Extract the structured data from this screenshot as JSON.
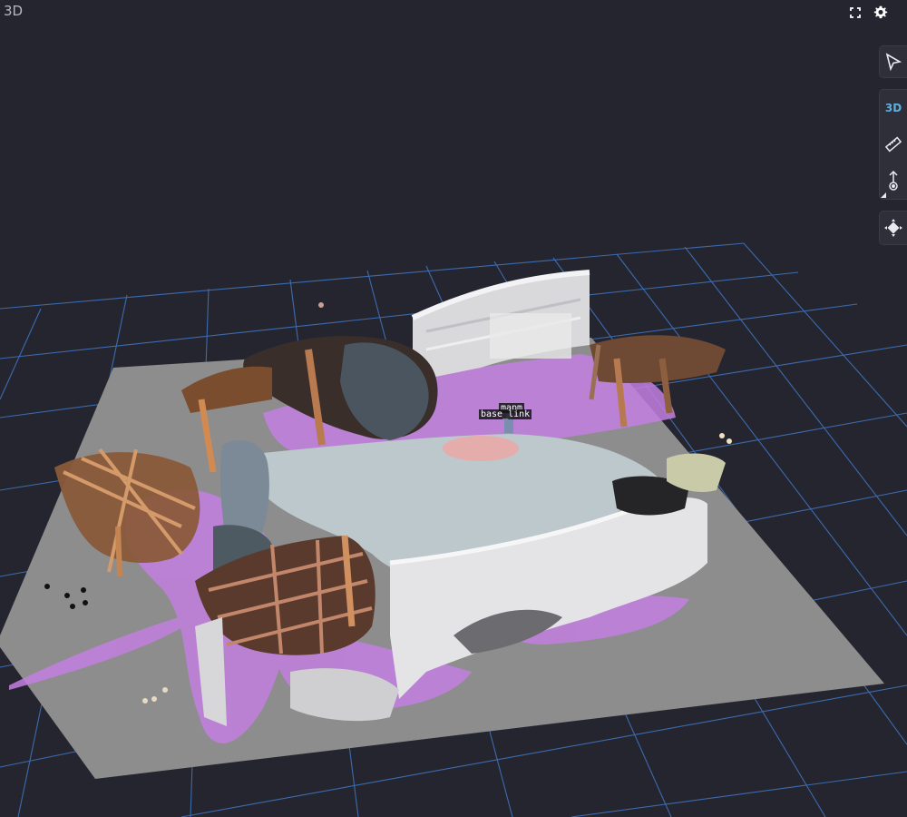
{
  "panel": {
    "title": "3D"
  },
  "top_right": {
    "icons": [
      "fullscreen-icon",
      "gear-icon"
    ]
  },
  "toolbar": {
    "select_icon": "cursor-arrow-icon",
    "mode_label": "3D",
    "measure_icon": "ruler-icon",
    "publish_icon": "publish-pose-icon",
    "move_icon": "move-arrows-icon"
  },
  "frames": {
    "map_label": "mapm",
    "base_label": "base_link"
  },
  "colors": {
    "background": "#252530",
    "grid": "#3e6fb4",
    "floor": "#8d8d8d",
    "costmap": "#c27fe0",
    "free_space": "#bcc8cc",
    "accent": "#5ab1e0"
  }
}
